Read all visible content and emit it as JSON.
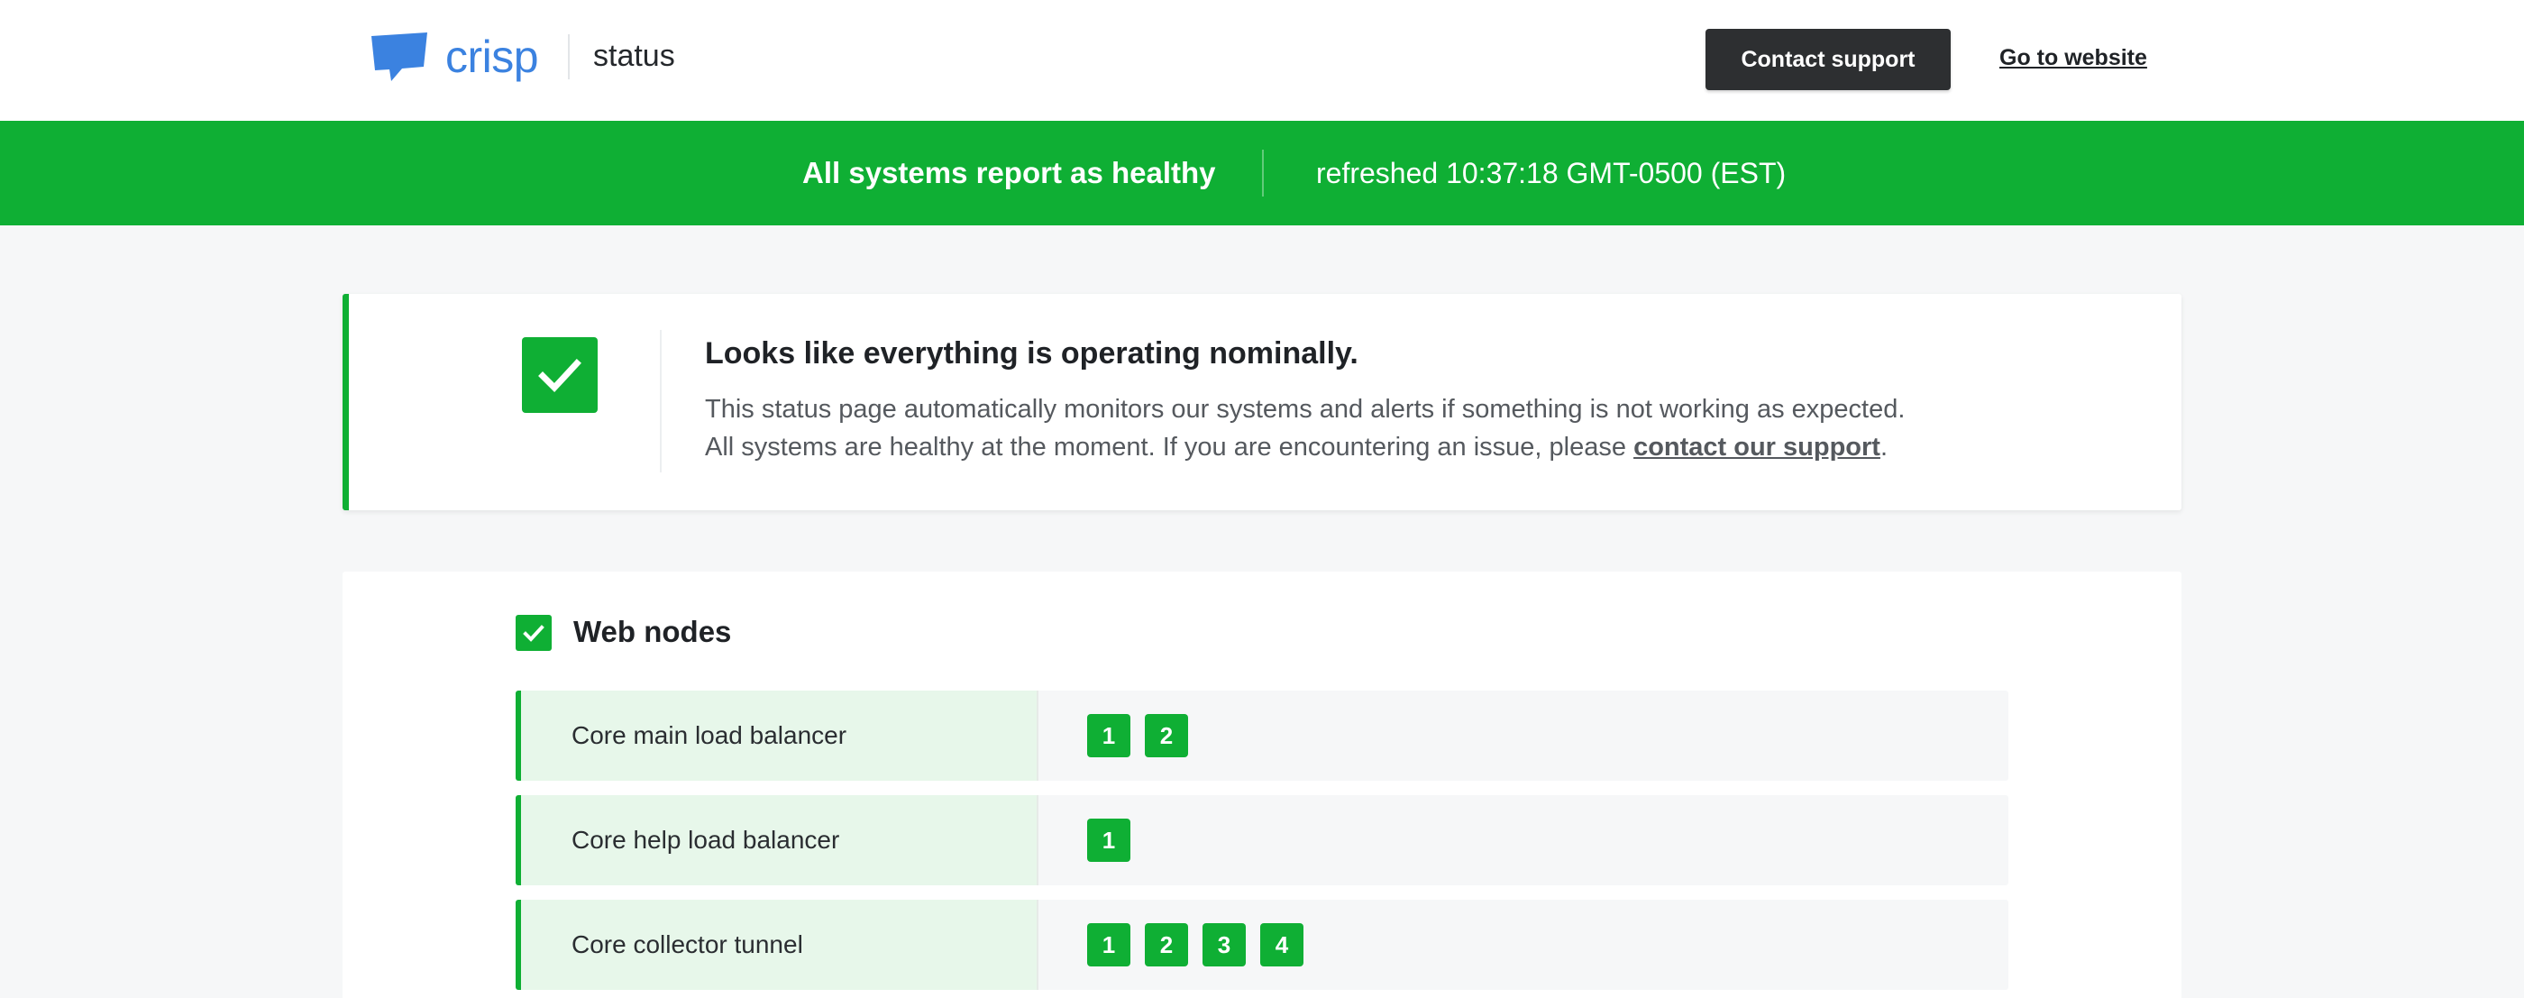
{
  "header": {
    "logo_text": "crisp",
    "logo_sub": "status",
    "contact_button": "Contact support",
    "website_link": "Go to website",
    "colors": {
      "brand": "#3b82e0",
      "button_bg": "#2d2f31"
    }
  },
  "banner": {
    "title": "All systems report as healthy",
    "refreshed": "refreshed 10:37:18 GMT-0500 (EST)",
    "color": "#0faf34"
  },
  "summary": {
    "icon": "check-icon",
    "title": "Looks like everything is operating nominally.",
    "line1": "This status page automatically monitors our systems and alerts if something is not working as expected.",
    "line2_prefix": "All systems are healthy at the moment. If you are encountering an issue, please ",
    "line2_link": "contact our support",
    "line2_suffix": "."
  },
  "services": {
    "icon": "check-icon",
    "title": "Web nodes",
    "rows": [
      {
        "label": "Core main load balancer",
        "nodes": [
          "1",
          "2"
        ]
      },
      {
        "label": "Core help load balancer",
        "nodes": [
          "1"
        ]
      },
      {
        "label": "Core collector tunnel",
        "nodes": [
          "1",
          "2",
          "3",
          "4"
        ]
      }
    ]
  }
}
